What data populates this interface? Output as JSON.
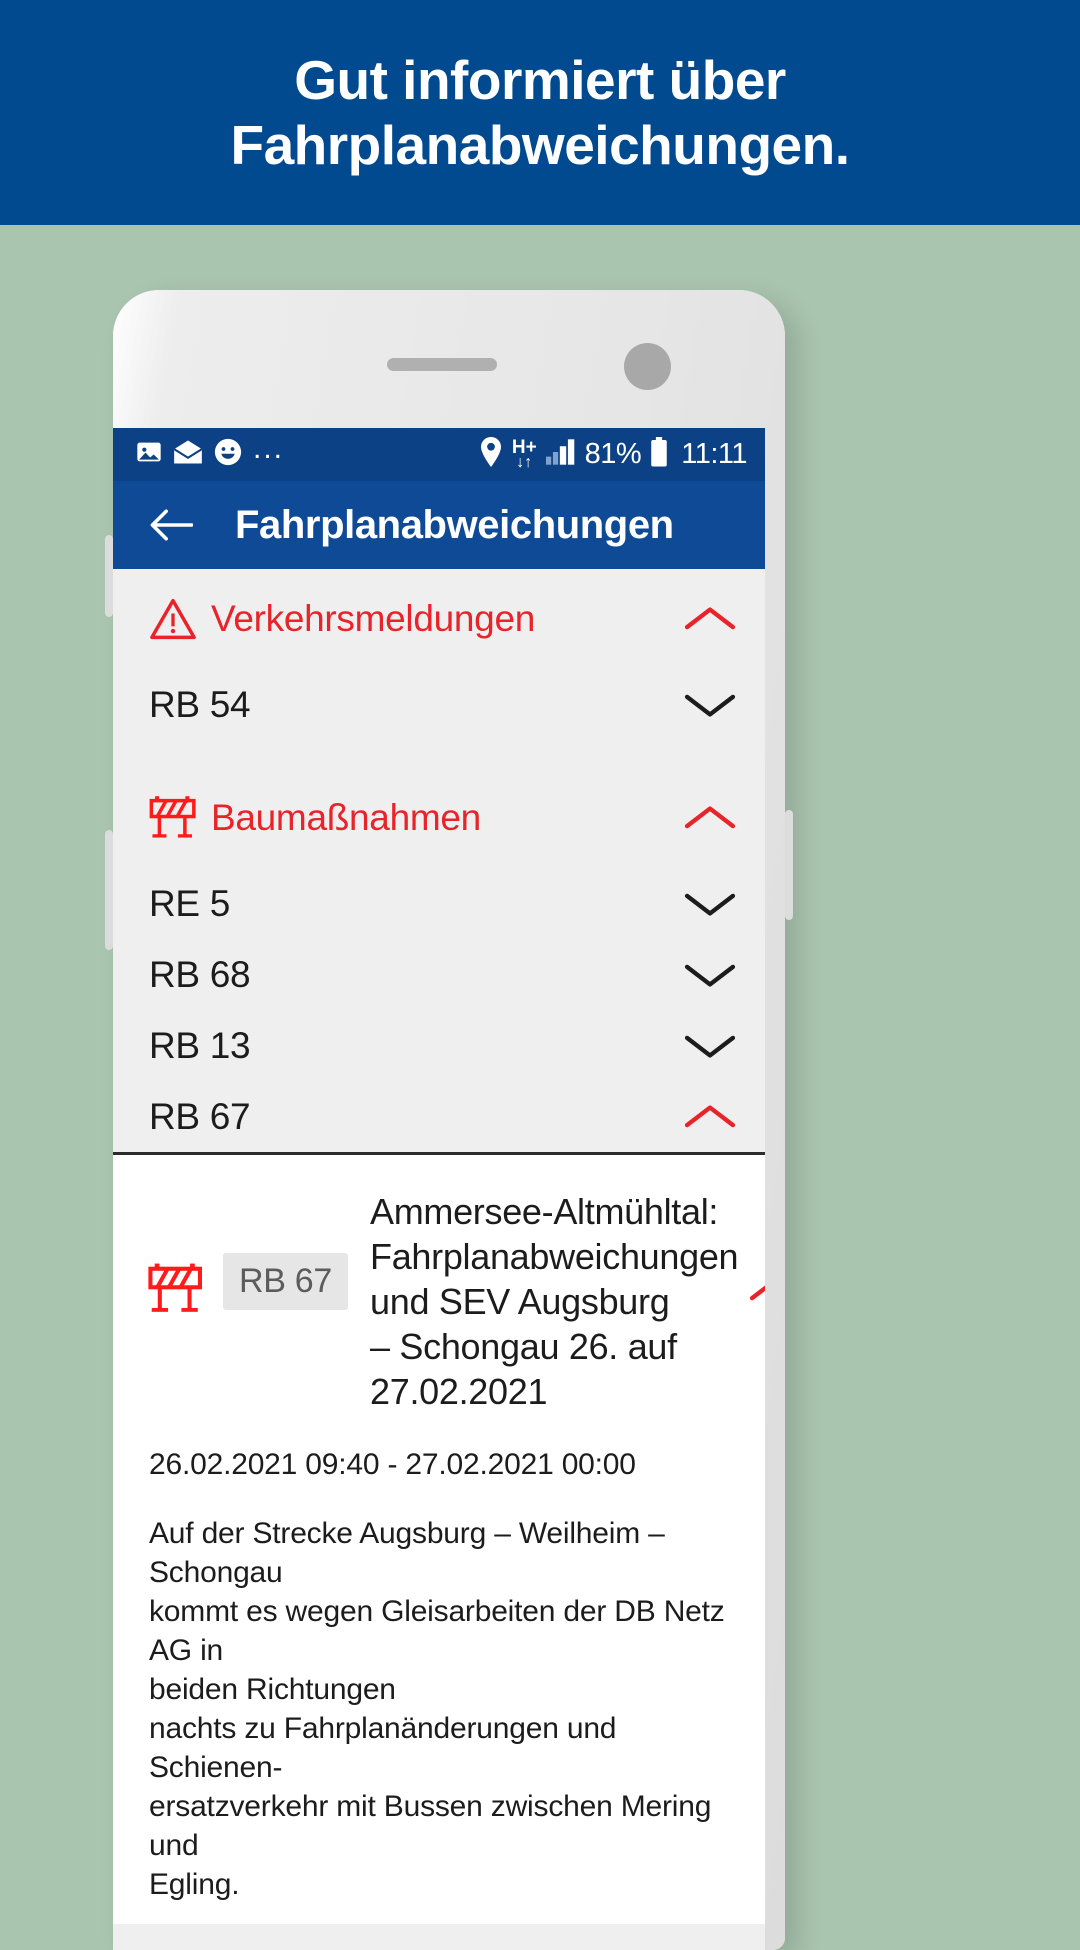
{
  "banner": {
    "headline": "Gut informiert über\nFahrplanabweichungen."
  },
  "colors": {
    "banner_blue": "#014a8f",
    "statusbar_blue": "#0c4185",
    "appbar_blue": "#0e4a96",
    "alert_red": "#e8232a",
    "page_bg": "#a9c4af",
    "list_bg": "#efefef",
    "card_bg": "#ffffff"
  },
  "statusbar": {
    "left_icons": [
      "image-icon",
      "envelope-icon",
      "smiley-icon",
      "overflow-dots-icon"
    ],
    "dots": "...",
    "right_icons": [
      "location-pin-icon",
      "hplus-network-icon",
      "signal-bars-icon",
      "battery-icon"
    ],
    "network_label_top": "H+",
    "network_label_bottom": "↓↑",
    "battery_percent": "81%",
    "time": "11:11"
  },
  "appbar": {
    "back_icon": "back-arrow-icon",
    "title": "Fahrplanabweichungen"
  },
  "sections": [
    {
      "icon": "warning-triangle-icon",
      "label": "Verkehrsmeldungen",
      "chevron": "chevron-up-icon",
      "expanded": true,
      "routes": [
        {
          "label": "RB 54",
          "chevron": "chevron-down-icon",
          "expanded": false
        }
      ]
    },
    {
      "icon": "construction-barrier-icon",
      "label": "Baumaßnahmen",
      "chevron": "chevron-up-icon",
      "expanded": true,
      "routes": [
        {
          "label": "RE 5",
          "chevron": "chevron-down-icon",
          "expanded": false
        },
        {
          "label": "RB 68",
          "chevron": "chevron-down-icon",
          "expanded": false
        },
        {
          "label": "RB 13",
          "chevron": "chevron-down-icon",
          "expanded": false
        },
        {
          "label": "RB 67",
          "chevron": "chevron-up-icon",
          "expanded": true
        }
      ]
    }
  ],
  "detail": {
    "icon": "construction-barrier-icon",
    "chip": "RB 67",
    "chevron": "chevron-up-icon",
    "title": "Ammersee-Altmühltal:\nFahrplanabweichungen\nund SEV Augsburg\n– Schongau 26. auf\n27.02.2021",
    "date_range": "26.02.2021 09:40 - 27.02.2021 00:00",
    "body": "Auf der Strecke Augsburg – Weilheim – Schongau\nkommt es wegen Gleisarbeiten der DB Netz AG in\nbeiden Richtungen\nnachts zu Fahrplanänderungen und Schienen-\nersatzverkehr mit Bussen zwischen Mering und\nEgling."
  }
}
